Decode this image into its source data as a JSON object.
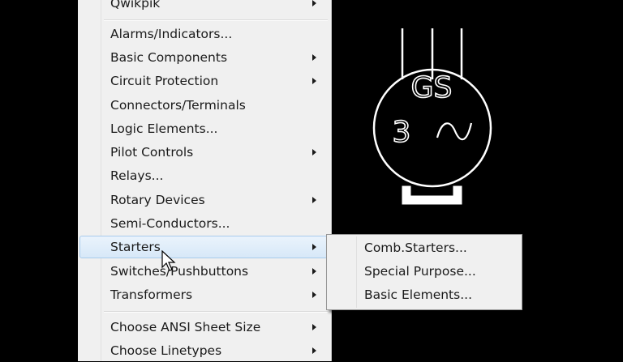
{
  "menu": {
    "items": [
      {
        "label": "Qwikpik",
        "has_submenu": true
      },
      {
        "label": "Alarms/Indicators...",
        "has_submenu": false
      },
      {
        "label": "Basic Components",
        "has_submenu": true
      },
      {
        "label": "Circuit Protection",
        "has_submenu": true
      },
      {
        "label": "Connectors/Terminals",
        "has_submenu": false
      },
      {
        "label": "Logic Elements...",
        "has_submenu": false
      },
      {
        "label": "Pilot Controls",
        "has_submenu": true
      },
      {
        "label": "Relays...",
        "has_submenu": false
      },
      {
        "label": "Rotary Devices",
        "has_submenu": true
      },
      {
        "label": "Semi-Conductors...",
        "has_submenu": false
      },
      {
        "label": "Starters",
        "has_submenu": true
      },
      {
        "label": "Switches/Pushbuttons",
        "has_submenu": true
      },
      {
        "label": "Transformers",
        "has_submenu": true
      },
      {
        "label": "Choose ANSI Sheet Size",
        "has_submenu": true
      },
      {
        "label": "Choose Linetypes",
        "has_submenu": true
      }
    ],
    "highlighted": "Starters"
  },
  "submenu": {
    "items": [
      {
        "label": "Comb.Starters..."
      },
      {
        "label": "Special Purpose..."
      },
      {
        "label": "Basic Elements..."
      }
    ]
  },
  "symbol": {
    "top_text": "GS",
    "phase": "3",
    "ac_glyph": "~"
  },
  "colors": {
    "canvas": "#000000",
    "menu_bg": "#f0f0f0",
    "highlight": "#d7e8f8",
    "symbol_stroke": "#ffffff"
  }
}
